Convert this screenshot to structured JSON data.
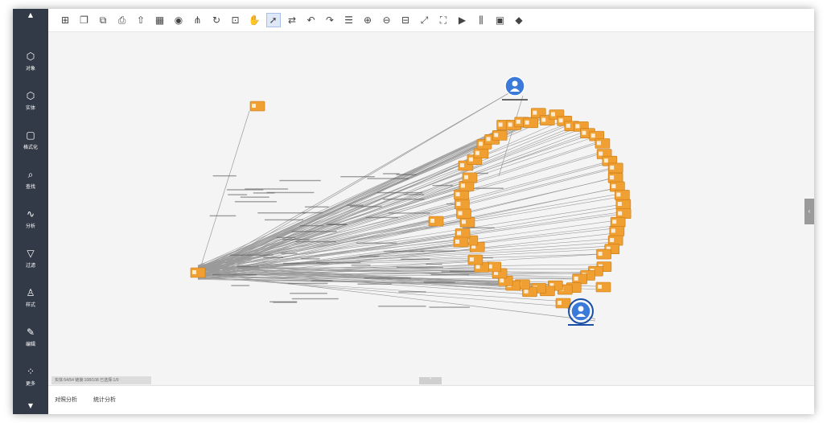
{
  "toolbar": {
    "icons": [
      {
        "name": "add-entity-icon",
        "glyph": "⊞"
      },
      {
        "name": "copy-icon",
        "glyph": "❐"
      },
      {
        "name": "paste-icon",
        "glyph": "⧉"
      },
      {
        "name": "save-icon",
        "glyph": "⎙"
      },
      {
        "name": "export-icon",
        "glyph": "⇧"
      },
      {
        "name": "grid-icon",
        "glyph": "▦"
      },
      {
        "name": "eye-icon",
        "glyph": "◉"
      },
      {
        "name": "hierarchy-icon",
        "glyph": "⋔"
      },
      {
        "name": "refresh-icon",
        "glyph": "↻"
      },
      {
        "name": "lock-icon",
        "glyph": "⊡"
      },
      {
        "name": "hand-icon",
        "glyph": "✋"
      },
      {
        "name": "select-arrow-icon",
        "glyph": "➚"
      },
      {
        "name": "connect-icon",
        "glyph": "⇄"
      },
      {
        "name": "undo-icon",
        "glyph": "↶"
      },
      {
        "name": "redo-icon",
        "glyph": "↷"
      },
      {
        "name": "list-icon",
        "glyph": "☰"
      },
      {
        "name": "zoom-in-icon",
        "glyph": "⊕"
      },
      {
        "name": "zoom-out-icon",
        "glyph": "⊖"
      },
      {
        "name": "fit-screen-icon",
        "glyph": "⊟"
      },
      {
        "name": "expand-icon",
        "glyph": "⤢"
      },
      {
        "name": "fullscreen-icon",
        "glyph": "⛶"
      },
      {
        "name": "play-icon",
        "glyph": "▶"
      },
      {
        "name": "timeline-icon",
        "glyph": "⫼"
      },
      {
        "name": "snapshot-icon",
        "glyph": "▣"
      },
      {
        "name": "eraser-icon",
        "glyph": "◆"
      }
    ],
    "active_index": 11
  },
  "sidebar": {
    "items": [
      {
        "icon": "cube-icon",
        "glyph": "⬡",
        "label": "对象"
      },
      {
        "icon": "entity-icon",
        "glyph": "⬡",
        "label": "实体"
      },
      {
        "icon": "format-icon",
        "glyph": "▢",
        "label": "格式化"
      },
      {
        "icon": "search-icon",
        "glyph": "⌕",
        "label": "查找"
      },
      {
        "icon": "analysis-icon",
        "glyph": "∿",
        "label": "分析"
      },
      {
        "icon": "filter-icon",
        "glyph": "▽",
        "label": "过滤"
      },
      {
        "icon": "style-icon",
        "glyph": "♙",
        "label": "样式"
      },
      {
        "icon": "edit-icon",
        "glyph": "✎",
        "label": "编辑"
      },
      {
        "icon": "more-icon",
        "glyph": "⁘",
        "label": "更多"
      }
    ]
  },
  "status": {
    "text": "实体:54/54 链接:108/108 已选择:1/0"
  },
  "bottom_tabs": [
    "对照分析",
    "统计分析"
  ],
  "colors": {
    "node": "#f0a032",
    "person": "#3b7ad9",
    "edge": "#9a9a9a",
    "sidebar": "#333a47"
  }
}
